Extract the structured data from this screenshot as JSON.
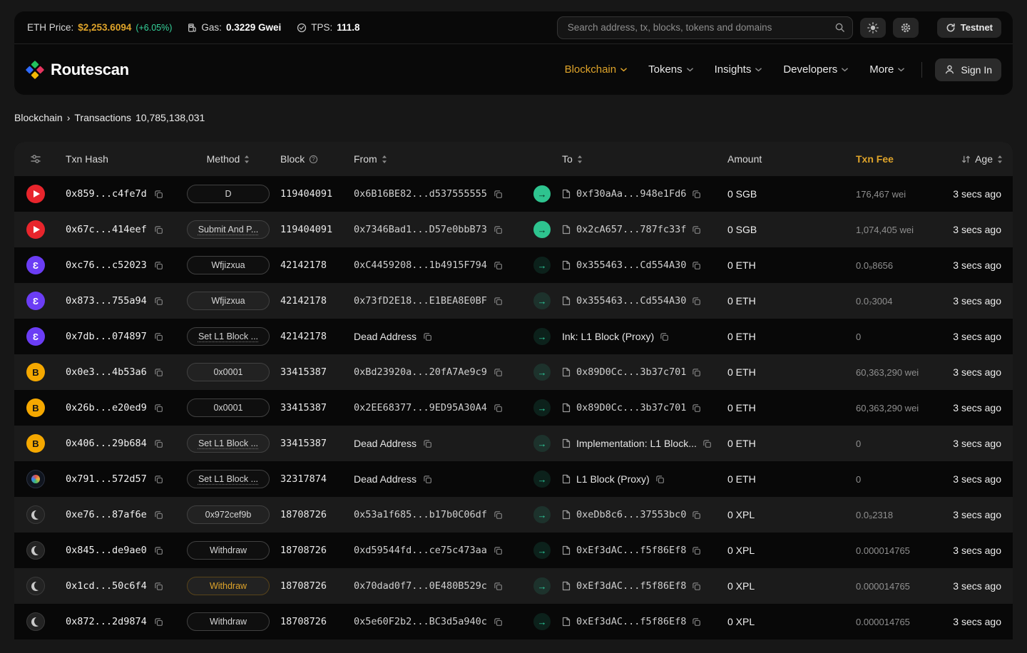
{
  "colors": {
    "accent_gold": "#dfa42a",
    "positive_green": "#35d49c",
    "arrow_green": "#2ed3a0"
  },
  "topbar": {
    "eth_price_label": "ETH Price:",
    "eth_price": "$2,253.6094",
    "eth_change": "(+6.05%)",
    "gas_label": "Gas:",
    "gas_value": "0.3229 Gwei",
    "tps_label": "TPS:",
    "tps_value": "111.8",
    "search_placeholder": "Search address, tx, blocks, tokens and domains",
    "network_button": "Testnet"
  },
  "nav": {
    "brand": "Routescan",
    "items": [
      {
        "label": "Blockchain",
        "active": true
      },
      {
        "label": "Tokens",
        "active": false
      },
      {
        "label": "Insights",
        "active": false
      },
      {
        "label": "Developers",
        "active": false
      },
      {
        "label": "More",
        "active": false
      }
    ],
    "sign_in": "Sign In"
  },
  "breadcrumb": {
    "section": "Blockchain",
    "separator": "›",
    "page": "Transactions",
    "count": "10,785,138,031"
  },
  "table": {
    "headers": {
      "txn_hash": "Txn Hash",
      "method": "Method",
      "block": "Block",
      "from": "From",
      "to": "To",
      "amount": "Amount",
      "txn_fee": "Txn Fee",
      "age": "Age"
    },
    "rows": [
      {
        "chain": "red",
        "hash": "0x859...c4fe7d",
        "method": "D",
        "method_gold": false,
        "block": "119404091",
        "from": "0x6B16BE82...d537555555",
        "from_type": "address",
        "to": "0xf30aAa...948e1Fd6",
        "to_type": "address",
        "to_doc": true,
        "amount": "0 SGB",
        "fee": "176,467 wei",
        "age": "3 secs ago",
        "arrow": "solid"
      },
      {
        "chain": "red",
        "hash": "0x67c...414eef",
        "method": "Submit And P...",
        "method_gold": false,
        "block": "119404091",
        "from": "0x7346Bad1...D57e0bbB73",
        "from_type": "address",
        "to": "0x2cA657...787fc33f",
        "to_type": "address",
        "to_doc": true,
        "amount": "0 SGB",
        "fee": "1,074,405 wei",
        "age": "3 secs ago",
        "arrow": "solid"
      },
      {
        "chain": "purple",
        "hash": "0xc76...c52023",
        "method": "Wfjizxua",
        "method_gold": false,
        "block": "42142178",
        "from": "0xC4459208...1b4915F794",
        "from_type": "address",
        "to": "0x355463...Cd554A30",
        "to_type": "address",
        "to_doc": true,
        "amount": "0 ETH",
        "fee": "0.0₉8656",
        "age": "3 secs ago",
        "arrow": "dark"
      },
      {
        "chain": "purple",
        "hash": "0x873...755a94",
        "method": "Wfjizxua",
        "method_gold": false,
        "block": "42142178",
        "from": "0x73fD2E18...E1BEA8E0BF",
        "from_type": "address",
        "to": "0x355463...Cd554A30",
        "to_type": "address",
        "to_doc": true,
        "amount": "0 ETH",
        "fee": "0.0₇3004",
        "age": "3 secs ago",
        "arrow": "dark"
      },
      {
        "chain": "purple",
        "hash": "0x7db...074897",
        "method": "Set L1 Block ...",
        "method_gold": false,
        "block": "42142178",
        "from": "Dead Address",
        "from_type": "name",
        "to": "Ink: L1 Block (Proxy)",
        "to_type": "name",
        "to_doc": false,
        "amount": "0 ETH",
        "fee": "0",
        "age": "3 secs ago",
        "arrow": "dark"
      },
      {
        "chain": "yellow",
        "hash": "0x0e3...4b53a6",
        "method": "0x0001",
        "method_gold": false,
        "block": "33415387",
        "from": "0xBd23920a...20fA7Ae9c9",
        "from_type": "address",
        "to": "0x89D0Cc...3b37c701",
        "to_type": "address",
        "to_doc": true,
        "amount": "0 ETH",
        "fee": "60,363,290 wei",
        "age": "3 secs ago",
        "arrow": "dark"
      },
      {
        "chain": "yellow",
        "hash": "0x26b...e20ed9",
        "method": "0x0001",
        "method_gold": false,
        "block": "33415387",
        "from": "0x2EE68377...9ED95A30A4",
        "from_type": "address",
        "to": "0x89D0Cc...3b37c701",
        "to_type": "address",
        "to_doc": true,
        "amount": "0 ETH",
        "fee": "60,363,290 wei",
        "age": "3 secs ago",
        "arrow": "dark"
      },
      {
        "chain": "yellow",
        "hash": "0x406...29b684",
        "method": "Set L1 Block ...",
        "method_gold": false,
        "block": "33415387",
        "from": "Dead Address",
        "from_type": "name",
        "to": "Implementation: L1 Block...",
        "to_type": "name",
        "to_doc": true,
        "amount": "0 ETH",
        "fee": "0",
        "age": "3 secs ago",
        "arrow": "dark"
      },
      {
        "chain": "dark",
        "hash": "0x791...572d57",
        "method": "Set L1 Block ...",
        "method_gold": false,
        "block": "32317874",
        "from": "Dead Address",
        "from_type": "name",
        "to": "L1 Block (Proxy)",
        "to_type": "name",
        "to_doc": true,
        "amount": "0 ETH",
        "fee": "0",
        "age": "3 secs ago",
        "arrow": "dark"
      },
      {
        "chain": "gray",
        "hash": "0xe76...87af6e",
        "method": "0x972cef9b",
        "method_gold": false,
        "block": "18708726",
        "from": "0x53a1f685...b17b0C06df",
        "from_type": "address",
        "to": "0xeDb8c6...37553bc0",
        "to_type": "address",
        "to_doc": true,
        "amount": "0 XPL",
        "fee": "0.0₉2318",
        "age": "3 secs ago",
        "arrow": "dark"
      },
      {
        "chain": "gray",
        "hash": "0x845...de9ae0",
        "method": "Withdraw",
        "method_gold": false,
        "block": "18708726",
        "from": "0xd59544fd...ce75c473aa",
        "from_type": "address",
        "to": "0xEf3dAC...f5f86Ef8",
        "to_type": "address",
        "to_doc": true,
        "amount": "0 XPL",
        "fee": "0.000014765",
        "age": "3 secs ago",
        "arrow": "dark"
      },
      {
        "chain": "gray",
        "hash": "0x1cd...50c6f4",
        "method": "Withdraw",
        "method_gold": true,
        "block": "18708726",
        "from": "0x70dad0f7...0E480B529c",
        "from_type": "address",
        "to": "0xEf3dAC...f5f86Ef8",
        "to_type": "address",
        "to_doc": true,
        "amount": "0 XPL",
        "fee": "0.000014765",
        "age": "3 secs ago",
        "arrow": "dark"
      },
      {
        "chain": "gray",
        "hash": "0x872...2d9874",
        "method": "Withdraw",
        "method_gold": false,
        "block": "18708726",
        "from": "0x5e60F2b2...BC3d5a940c",
        "from_type": "address",
        "to": "0xEf3dAC...f5f86Ef8",
        "to_type": "address",
        "to_doc": true,
        "amount": "0 XPL",
        "fee": "0.000014765",
        "age": "3 secs ago",
        "arrow": "dark"
      }
    ]
  }
}
